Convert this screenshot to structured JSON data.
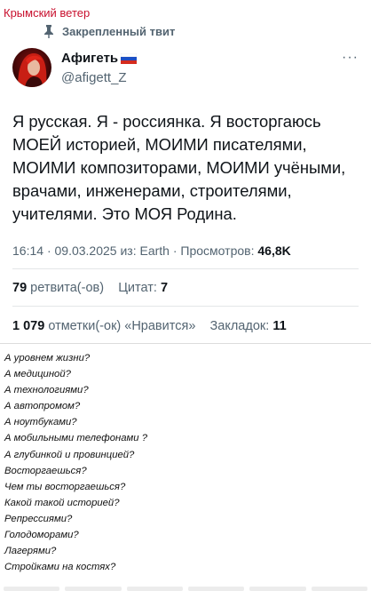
{
  "channel": {
    "name": "Крымский ветер"
  },
  "pinned": {
    "label": "Закрепленный твит"
  },
  "author": {
    "name": "Афигеть",
    "handle": "@afigett_Z"
  },
  "tweet": {
    "text": "Я русская. Я - россиянка. Я восторгаюсь МОЕЙ историей, МОИМИ писателями, МОИМИ композиторами, МОИМИ учёными, врачами, инженерами, строителями, учителями. Это МОЯ Родина.",
    "meta": {
      "time": "16:14",
      "date": "09.03.2025",
      "source_prefix": "из:",
      "source": "Earth",
      "views_label": "Просмотров:",
      "views": "46,8K"
    },
    "stats": {
      "retweets_count": "79",
      "retweets_label": "ретвита(-ов)",
      "quotes_label": "Цитат:",
      "quotes_count": "7",
      "likes_count": "1 079",
      "likes_label": "отметки(-ок) «Нравится»",
      "bookmarks_label": "Закладок:",
      "bookmarks_count": "11"
    }
  },
  "reply_lines": [
    "А уровнем жизни?",
    "А медициной?",
    "А технологиями?",
    "А автопромом?",
    "А ноутбуками?",
    "А мобильными телефонами ?",
    "А глубинкой и провинцией?",
    "Восторгаешься?",
    "Чем ты восторгаешься?",
    "Какой такой историей?",
    "Репрессиями?",
    "Голодоморами?",
    "Лагерями?",
    "Стройками на костях?"
  ],
  "colors": {
    "channel_red": "#c8102e",
    "text_primary": "#0f1419",
    "text_secondary": "#536471"
  },
  "icons": {
    "pin": "pin-icon",
    "more": "more-icon",
    "flag": "russia-flag-icon"
  }
}
